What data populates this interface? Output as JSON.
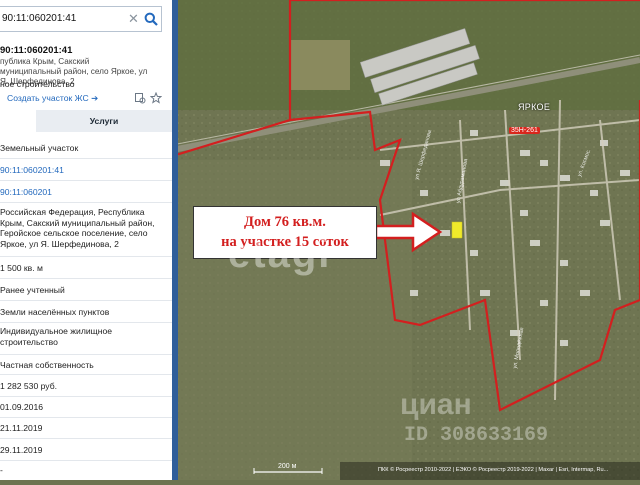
{
  "search": {
    "value": "90:11:060201:41",
    "clear_glyph": "✕"
  },
  "parcel": {
    "cadastral_number": "90:11:060201:41",
    "address": "публика Крым, Сакский муниципальный район, село Яркое, ул Я. Шерфединова, 2",
    "kind_partial": "ное строительство",
    "create_link": "Создать участок ЖС ➔"
  },
  "tabs": {
    "services_label": "Услуги"
  },
  "details": [
    "Земельный участок",
    "90:11:060201:41",
    "90:11:060201",
    "Российская Федерация, Республика Крым, Сакский муниципальный район, Геройское сельское поселение, село Яркое, ул Я. Шерфединова, 2",
    "1 500 кв. м",
    "Ранее учтенный",
    "Земли населённых пунктов",
    "Индивидуальное жилищное строительство",
    "Частная собственность",
    "1 282 530 руб.",
    "01.09.2016",
    "21.11.2019",
    "29.11.2019",
    "-"
  ],
  "map": {
    "caption_line1": "Дом 76 кв.м.",
    "caption_line2": "на участке 15 соток",
    "village_label": "ЯРКОЕ",
    "road_number": "35Н-261",
    "scale_label": "200 м",
    "attribution": "ПКК © Росреестр 2010-2022 | ЕЭКО © Росреестр 2019-2022 | Maxar | Esri, Intermap, Ru...",
    "watermark_etagi": "etagi",
    "watermark_cian": "циан",
    "watermark_id": "ID 308633169",
    "street_labels": [
      "ул Я. Шерфединова",
      "ул Абдураманова",
      "ул. Космос.",
      "ул. Молодёжная"
    ]
  },
  "colors": {
    "link_blue": "#2369bd",
    "boundary_red": "#d31f1f",
    "parcel_yellow": "#f0ea2a"
  },
  "icons": [
    "search-icon",
    "clear-icon",
    "bookmark-icon",
    "star-icon",
    "arrow-right-icon"
  ]
}
